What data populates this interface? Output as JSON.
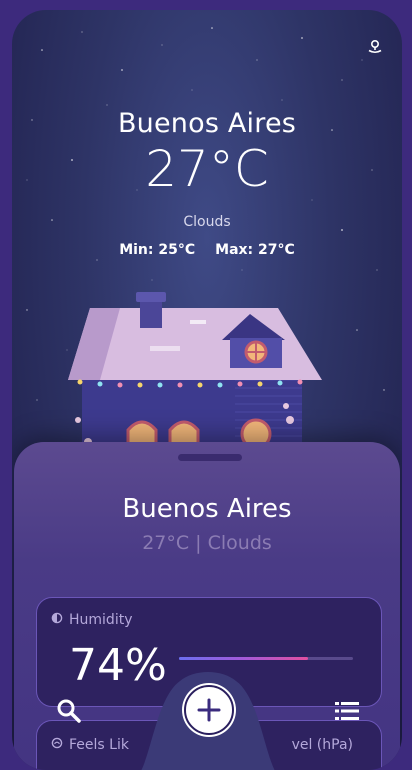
{
  "location": {
    "city": "Buenos Aires",
    "temperature": "27°C",
    "condition": "Clouds",
    "min": "Min: 25°C",
    "max": "Max: 27°C"
  },
  "sheet": {
    "city": "Buenos Aires",
    "summary": "27°C | Clouds"
  },
  "humidity": {
    "label": "Humidity",
    "value": "74%",
    "level": 0.74
  },
  "feels_like": {
    "label_left": "Feels Lik",
    "label_right": "vel (hPa)"
  },
  "icons": {
    "top_right": "location-pin-icon",
    "humidity": "water-drop-icon",
    "feels_like": "thermometer-gauge-icon",
    "nav_left": "search-icon",
    "nav_center": "add-icon",
    "nav_right": "list-icon"
  },
  "colors": {
    "background": "#3d2a7d",
    "card": "#2e2260",
    "card_border": "#6b56b8",
    "accent_start": "#6c6ff0",
    "accent_end": "#e24fa0"
  }
}
